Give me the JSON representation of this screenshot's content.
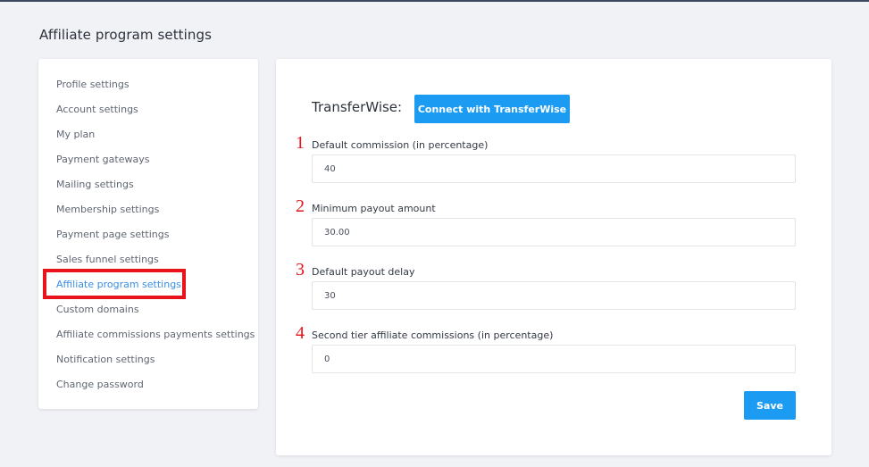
{
  "page_title": "Affiliate program settings",
  "sidebar": {
    "items": [
      {
        "label": "Profile settings"
      },
      {
        "label": "Account settings"
      },
      {
        "label": "My plan"
      },
      {
        "label": "Payment gateways"
      },
      {
        "label": "Mailing settings"
      },
      {
        "label": "Membership settings"
      },
      {
        "label": "Payment page settings"
      },
      {
        "label": "Sales funnel settings"
      },
      {
        "label": "Affiliate program settings"
      },
      {
        "label": "Custom domains"
      },
      {
        "label": "Affiliate commissions payments settings"
      },
      {
        "label": "Notification settings"
      },
      {
        "label": "Change password"
      }
    ],
    "active_item": "Affiliate program settings"
  },
  "transferwise": {
    "label": "TransferWise:",
    "connect_button": "Connect with TransferWise"
  },
  "fields": [
    {
      "number": "1",
      "label": "Default commission (in percentage)",
      "value": "40"
    },
    {
      "number": "2",
      "label": "Minimum payout amount",
      "value": "30.00"
    },
    {
      "number": "3",
      "label": "Default payout delay",
      "value": "30"
    },
    {
      "number": "4",
      "label": "Second tier affiliate commissions (in percentage)",
      "value": "0"
    }
  ],
  "save_button": "Save",
  "colors": {
    "accent": "#1b9cf2",
    "active_link": "#3a8ee6",
    "annotation_red": "#e8131b",
    "background": "#f1f2f6"
  }
}
